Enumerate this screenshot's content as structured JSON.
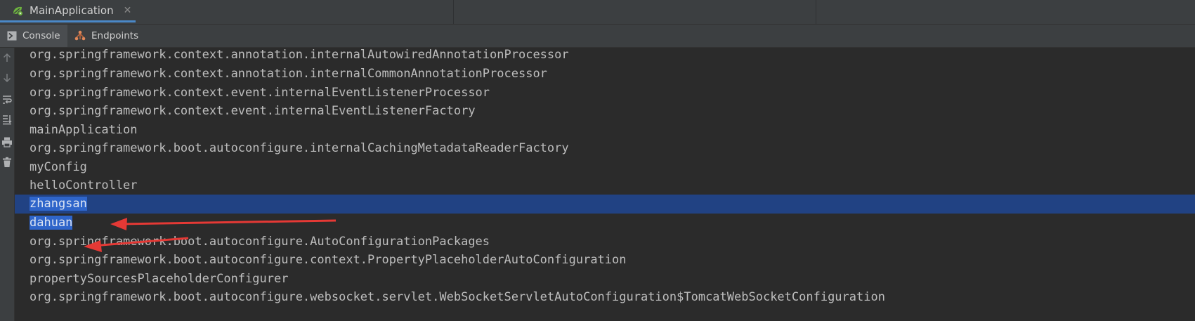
{
  "run_tab": {
    "label": "MainApplication",
    "close": "✕"
  },
  "toolbar": {
    "console_label": "Console",
    "endpoints_label": "Endpoints"
  },
  "console_lines": [
    "org.springframework.context.annotation.internalAutowiredAnnotationProcessor",
    "org.springframework.context.annotation.internalCommonAnnotationProcessor",
    "org.springframework.context.event.internalEventListenerProcessor",
    "org.springframework.context.event.internalEventListenerFactory",
    "mainApplication",
    "org.springframework.boot.autoconfigure.internalCachingMetadataReaderFactory",
    "myConfig",
    "helloController",
    "zhangsan",
    "dahuan",
    "org.springframework.boot.autoconfigure.AutoConfigurationPackages",
    "org.springframework.boot.autoconfigure.context.PropertyPlaceholderAutoConfiguration",
    "propertySourcesPlaceholderConfigurer",
    "org.springframework.boot.autoconfigure.websocket.servlet.WebSocketServletAutoConfiguration$TomcatWebSocketConfiguration"
  ],
  "highlighted_lines": [
    8,
    9
  ],
  "colors": {
    "accent": "#4a88c7",
    "selection": "#214283",
    "annotation_arrow": "#e53935"
  },
  "gutter_icons": [
    "scroll-up-icon",
    "scroll-down-icon",
    "soft-wrap-icon",
    "scroll-to-end-icon",
    "print-icon",
    "trash-icon"
  ]
}
